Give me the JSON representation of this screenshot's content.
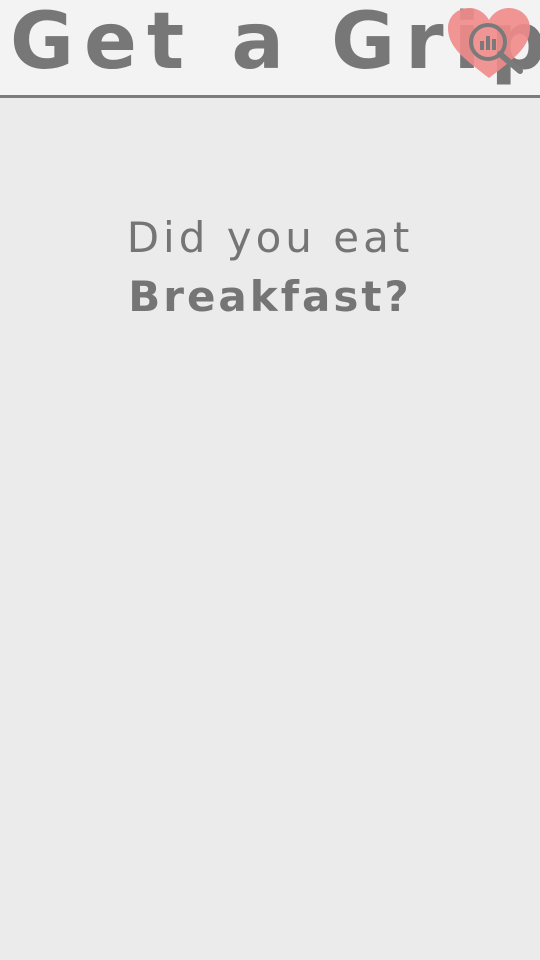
{
  "header": {
    "title": "Get a Grip",
    "logo_icon": "heart-magnifier-chart-icon",
    "logo_color": "#f08a8a"
  },
  "question": {
    "line1": "Did you eat",
    "line2": "Breakfast?"
  },
  "colors": {
    "background": "#ebebeb",
    "header_background": "#f3f3f3",
    "text": "#777777",
    "header_rule": "#7c7c7c"
  }
}
